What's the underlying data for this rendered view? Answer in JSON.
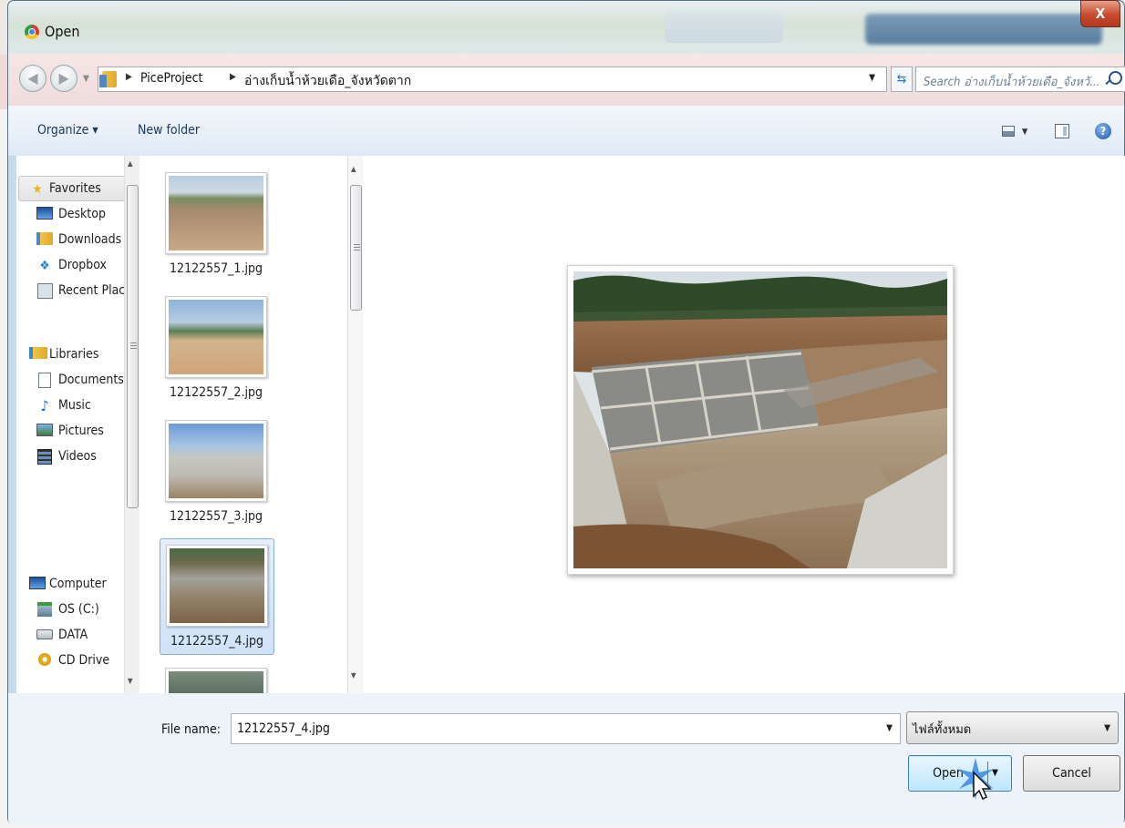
{
  "window": {
    "title": "Open",
    "close_label": "X"
  },
  "navigation": {
    "breadcrumb": [
      "PiceProject",
      "อ่างเก็บน้ำห้วยเดือ_จังหวัดตาก"
    ],
    "search_placeholder": "Search อ่างเก็บน้ำห้วยเดือ_จังหวั..."
  },
  "toolbar": {
    "organize_label": "Organize ▾",
    "new_folder_label": "New folder"
  },
  "sidebar": {
    "items": [
      {
        "label": "Favorites",
        "icon": "star-icon"
      },
      {
        "label": "Desktop",
        "icon": "desktop-icon"
      },
      {
        "label": "Downloads",
        "icon": "downloads-icon"
      },
      {
        "label": "Dropbox",
        "icon": "dropbox-icon"
      },
      {
        "label": "Recent Places",
        "icon": "recent-places-icon"
      },
      {
        "label": "Libraries",
        "icon": "libraries-icon"
      },
      {
        "label": "Documents",
        "icon": "documents-icon"
      },
      {
        "label": "Music",
        "icon": "music-icon"
      },
      {
        "label": "Pictures",
        "icon": "pictures-icon"
      },
      {
        "label": "Videos",
        "icon": "videos-icon"
      },
      {
        "label": "Computer",
        "icon": "computer-icon"
      },
      {
        "label": "OS (C:)",
        "icon": "os-drive-icon"
      },
      {
        "label": "DATA",
        "icon": "drive-icon"
      },
      {
        "label": "CD Drive",
        "icon": "cd-drive-icon"
      }
    ]
  },
  "files": [
    {
      "name": "12122557_1.jpg",
      "selected": false
    },
    {
      "name": "12122557_2.jpg",
      "selected": false
    },
    {
      "name": "12122557_3.jpg",
      "selected": false
    },
    {
      "name": "12122557_4.jpg",
      "selected": true
    }
  ],
  "footer": {
    "file_name_label": "File name:",
    "file_name_value": "12122557_4.jpg",
    "file_type_value": "ไฟล์ทั้งหมด",
    "open_label": "Open",
    "cancel_label": "Cancel"
  },
  "colors": {
    "accent": "#3c7fb1",
    "selection": "#cfe2f8",
    "close_button": "#c74a2e"
  }
}
